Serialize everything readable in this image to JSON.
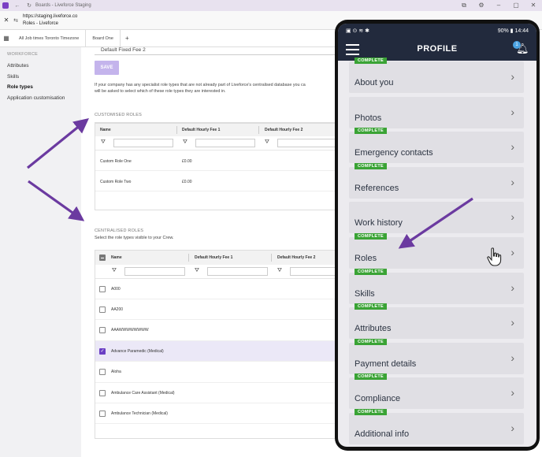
{
  "window": {
    "title": "Boards - Liveforce Staging"
  },
  "urlbar": {
    "url": "https://staging.liveforce.co",
    "page_title": "Roles - Liveforce"
  },
  "tabs": [
    "All Job times Toronto Timezone",
    "Board One"
  ],
  "sidebar": {
    "section": "WORKFORCE",
    "items": [
      {
        "label": "Attributes",
        "active": false
      },
      {
        "label": "Skills",
        "active": false
      },
      {
        "label": "Role types",
        "active": true
      },
      {
        "label": "Application customisation",
        "active": false
      }
    ]
  },
  "main": {
    "field_value": "Default Fixed Fee 2",
    "save_label": "SAVE",
    "info_line1": "If your company has any specialist role types that are not already part of Liveforce's centralised database you ca",
    "info_line2": "will be asked to select which of these role types they are interested in.",
    "customised": {
      "heading": "CUSTOMISED ROLES",
      "columns": [
        "Name",
        "Default Hourly Fee 1",
        "Default Hourly Fee 2"
      ],
      "rows": [
        {
          "name": "Custom Role One",
          "fee1": "£0.00"
        },
        {
          "name": "Custom Role Two",
          "fee1": "£0.00"
        }
      ]
    },
    "centralised": {
      "heading": "CENTRALISED ROLES",
      "subtitle": "Select the role types visible to your Crew.",
      "columns": [
        "Name",
        "Default Hourly Fee 1",
        "Default Hourly Fee 2"
      ],
      "rows": [
        {
          "name": "A000",
          "checked": false
        },
        {
          "name": "AA200",
          "checked": false
        },
        {
          "name": "AAAWWWWWWWW",
          "checked": false
        },
        {
          "name": "Advance Paramedic (Medical)",
          "checked": true
        },
        {
          "name": "Aloha",
          "checked": false
        },
        {
          "name": "Ambulance Care Assistant (Medical)",
          "checked": false
        },
        {
          "name": "Ambulance Technician (Medical)",
          "checked": false
        }
      ]
    }
  },
  "phone": {
    "status_left": "▣ ⊙ ≋ ✱",
    "status_right": "90% ▮ 14:44",
    "title": "PROFILE",
    "notification_count": "1",
    "complete_label": "COMPLETE",
    "items": [
      {
        "label": "About you",
        "complete": true
      },
      {
        "label": "Photos",
        "complete": false
      },
      {
        "label": "Emergency contacts",
        "complete": true
      },
      {
        "label": "References",
        "complete": true
      },
      {
        "label": "Work history",
        "complete": false
      },
      {
        "label": "Roles",
        "complete": true
      },
      {
        "label": "Skills",
        "complete": true
      },
      {
        "label": "Attributes",
        "complete": true
      },
      {
        "label": "Payment details",
        "complete": true
      },
      {
        "label": "Compliance",
        "complete": true
      },
      {
        "label": "Additional info",
        "complete": true
      }
    ]
  },
  "colors": {
    "accent": "#6a3fc4",
    "annotation": "#6b3aa0",
    "complete_tag": "#3aa335",
    "phone_bar": "#222a3d"
  }
}
